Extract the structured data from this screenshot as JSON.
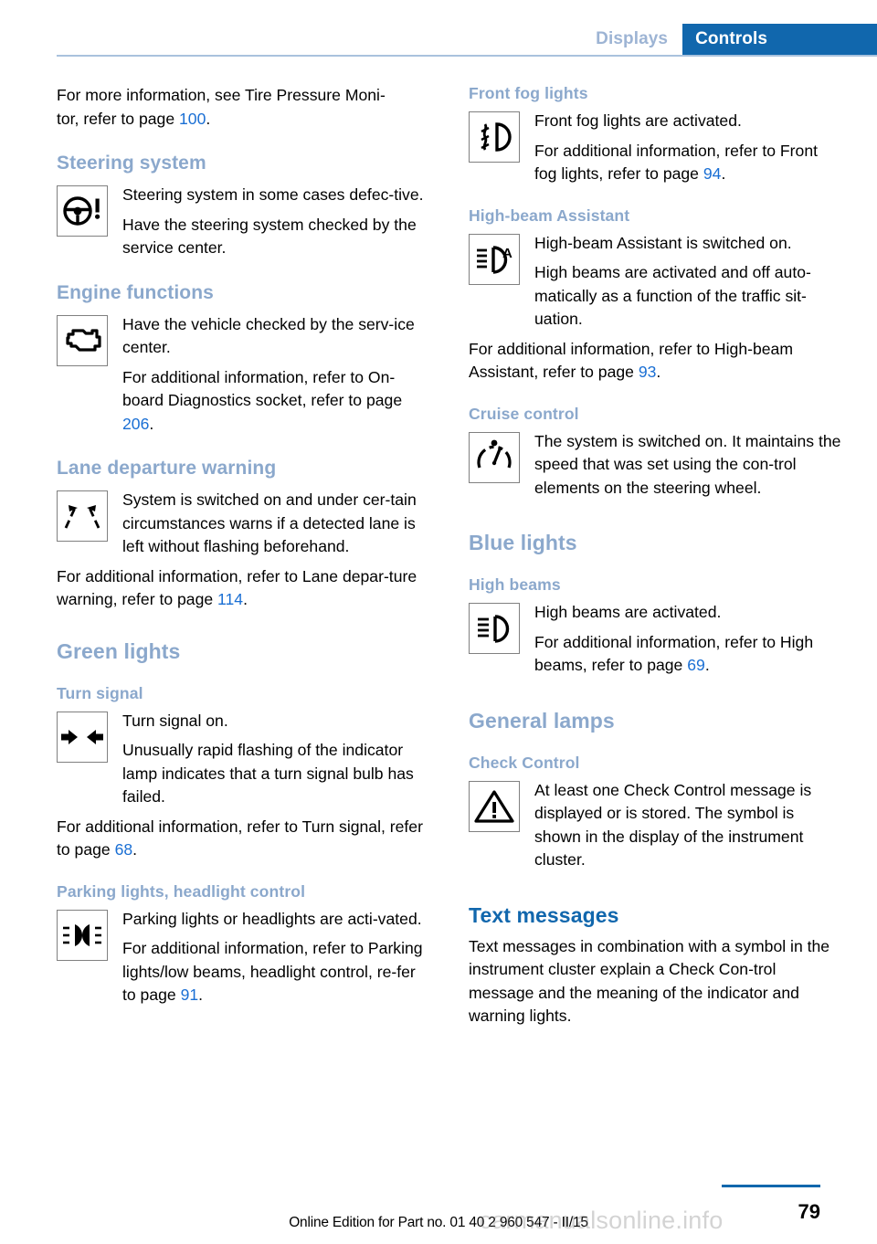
{
  "header": {
    "tab_inactive": "Displays",
    "tab_active": "Controls",
    "accent_color": "#1167ad",
    "heading_color": "#8ba8cc",
    "link_color": "#1a6fd4"
  },
  "left_column": {
    "intro": {
      "text_before": "For more information, see Tire Pressure Moni-tor, refer to page ",
      "line1": "For more information, see Tire Pressure Moni-",
      "line2_prefix": "tor, refer to page ",
      "page": "100",
      "line2_suffix": "."
    },
    "steering": {
      "heading": "Steering system",
      "icon": "steering-wheel-warning-icon",
      "para1": "Steering system in some cases defec-tive.",
      "para2": "Have the steering system checked by the service center."
    },
    "engine": {
      "heading": "Engine functions",
      "icon": "engine-check-icon",
      "para1": "Have the vehicle checked by the serv-ice center.",
      "para2_prefix": "For additional information, refer to On-board Diagnostics socket, refer to page ",
      "para2_page": "206",
      "para2_suffix": "."
    },
    "lane_departure": {
      "heading": "Lane departure warning",
      "icon": "lane-departure-warning-icon",
      "para1": "System is switched on and under cer-tain circumstances warns if a detected lane is left without flashing beforehand.",
      "para2_prefix": "For additional information, refer to Lane depar-ture warning, refer to page ",
      "para2_page": "114",
      "para2_suffix": "."
    },
    "green_lights": {
      "heading": "Green lights"
    },
    "turn_signal": {
      "heading": "Turn signal",
      "icon": "turn-signal-arrows-icon",
      "para1": "Turn signal on.",
      "para2": "Unusually rapid flashing of the indicator lamp indicates that a turn signal bulb has failed.",
      "para3_prefix": "For additional information, refer to Turn signal, refer to page ",
      "para3_page": "68",
      "para3_suffix": "."
    },
    "parking_lights": {
      "heading": "Parking lights, headlight control",
      "icon": "parking-lights-icon",
      "para1": "Parking lights or headlights are acti-vated.",
      "para2_prefix": "For additional information, refer to Parking lights/low beams, headlight control, re-fer to page ",
      "para2_page": "91",
      "para2_suffix": "."
    }
  },
  "right_column": {
    "front_fog": {
      "heading": "Front fog lights",
      "icon": "front-fog-light-icon",
      "para1": "Front fog lights are activated.",
      "para2_prefix": "For additional information, refer to Front fog lights, refer to page ",
      "para2_page": "94",
      "para2_suffix": "."
    },
    "high_beam_assistant": {
      "heading": "High-beam Assistant",
      "icon": "high-beam-assistant-icon",
      "para1": "High-beam Assistant is switched on.",
      "para2": "High beams are activated and off auto-matically as a function of the traffic sit-uation.",
      "para3_prefix": "For additional information, refer to High-beam Assistant, refer to page ",
      "para3_page": "93",
      "para3_suffix": "."
    },
    "cruise_control": {
      "heading": "Cruise control",
      "icon": "cruise-control-gauge-icon",
      "para1": "The system is switched on. It maintains the speed that was set using the con-trol elements on the steering wheel."
    },
    "blue_lights": {
      "heading": "Blue lights"
    },
    "high_beams": {
      "heading": "High beams",
      "icon": "high-beam-icon",
      "para1": "High beams are activated.",
      "para2_prefix": "For additional information, refer to High beams, refer to page ",
      "para2_page": "69",
      "para2_suffix": "."
    },
    "general_lamps": {
      "heading": "General lamps"
    },
    "check_control": {
      "heading": "Check Control",
      "icon": "warning-triangle-icon",
      "para1": "At least one Check Control message is displayed or is stored. The symbol is shown in the display of the instrument cluster."
    },
    "text_messages": {
      "heading": "Text messages",
      "para1": "Text messages in combination with a symbol in the instrument cluster explain a Check Con-trol message and the meaning of the indicator and warning lights."
    }
  },
  "footer": {
    "edition": "Online Edition for Part no. 01 40 2 960 547 - II/15",
    "page_number": "79",
    "watermark": "carmanualsonline.info"
  }
}
